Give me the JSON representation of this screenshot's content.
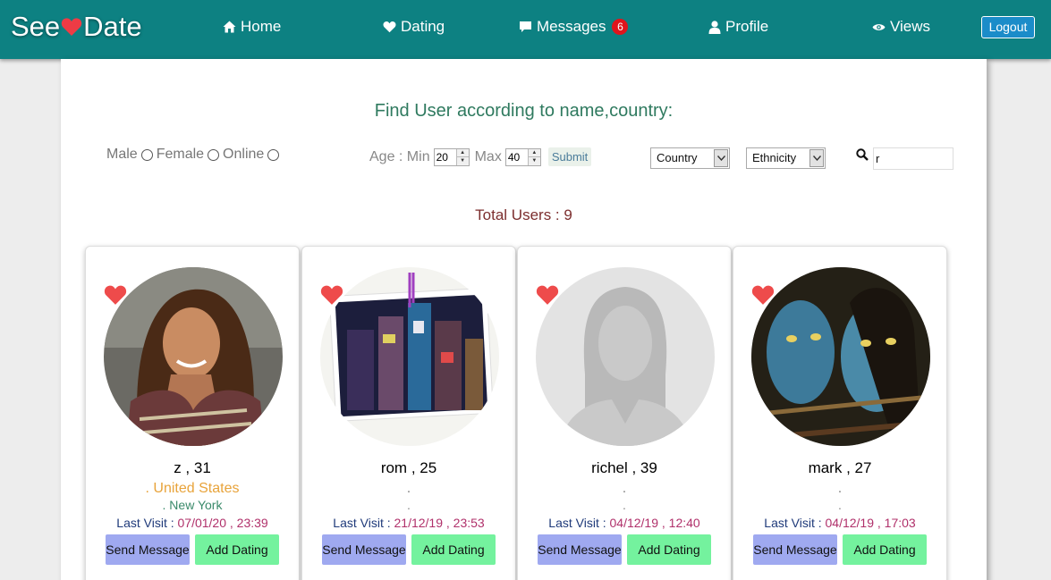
{
  "brand": {
    "left": "See",
    "right": "Date"
  },
  "nav": {
    "home": "Home",
    "dating": "Dating",
    "messages": "Messages",
    "messages_count": "6",
    "profile": "Profile",
    "views": "Views",
    "logout": "Logout"
  },
  "search": {
    "title": "Find User according to name,country:",
    "gender": {
      "male": "Male",
      "female": "Female",
      "online": "Online"
    },
    "age": {
      "label": "Age : Min",
      "max_label": "Max",
      "min": "20",
      "max": "40",
      "submit": "Submit"
    },
    "country": "Country",
    "ethnicity": "Ethnicity",
    "query": "r"
  },
  "total": "Total Users : 9",
  "users": [
    {
      "name": "z , 31",
      "country": ". United States",
      "city": ". New York",
      "visit_label": "Last Visit : ",
      "visit_time": "07/01/20 , 23:39",
      "send": "Send Message",
      "add": "Add Dating"
    },
    {
      "name": "rom , 25",
      "country": ".",
      "city": ".",
      "visit_label": "Last Visit : ",
      "visit_time": "21/12/19 , 23:53",
      "send": "Send Message",
      "add": "Add Dating"
    },
    {
      "name": "richel , 39",
      "country": ".",
      "city": ".",
      "visit_label": "Last Visit : ",
      "visit_time": "04/12/19 , 12:40",
      "send": "Send Message",
      "add": "Add Dating"
    },
    {
      "name": "mark , 27",
      "country": ".",
      "city": ".",
      "visit_label": "Last Visit : ",
      "visit_time": "04/12/19 , 17:03",
      "send": "Send Message",
      "add": "Add Dating"
    }
  ],
  "colors": {
    "nav_bg": "#0d8182",
    "heart": "#ee4b4b",
    "send_btn": "#9fa9f0",
    "add_btn": "#74f29e"
  }
}
